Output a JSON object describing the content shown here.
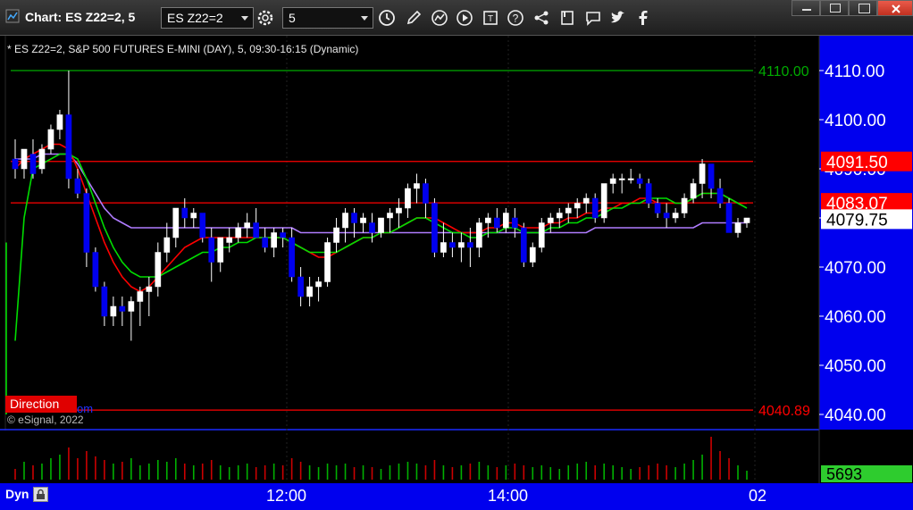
{
  "window": {
    "title": "Chart: ES Z22=2, 5",
    "symbol_value": "ES Z22=2",
    "interval_value": "5"
  },
  "chart": {
    "legend_text": "* ES Z22=2, S&P 500 FUTURES E-MINI (DAY), 5, 09:30-16:15 (Dynamic)",
    "copyright": "© eSignal, 2022",
    "direction_label": "Direction",
    "direction_tail": "om",
    "bottom_label": "Dyn"
  },
  "colors": {
    "background": "#000000",
    "price_axis_bg": "#0000ee",
    "up_candle": "#ffffff",
    "down_candle": "#0000ee",
    "ma_red": "#ff0000",
    "ma_green": "#00dd00",
    "ma_purple": "#b07cff",
    "level_green": "#00aa00",
    "level_red": "#ff0000",
    "volume_up": "#00b000",
    "volume_down": "#cc0000"
  },
  "icons": [
    "settings-icon",
    "clock-icon",
    "pencil-icon",
    "refresh-icon",
    "play-icon",
    "text-icon",
    "help-icon",
    "share-icon",
    "bookmark-icon",
    "chat-icon",
    "twitter-icon",
    "facebook-icon"
  ],
  "chart_data": {
    "type": "candlestick",
    "price_ticks": [
      4110,
      4100,
      4090,
      4080,
      4070,
      4060,
      4050,
      4040
    ],
    "price_tick_labels": [
      "4110.00",
      "4100.00",
      "4090.00",
      "4080.00",
      "4070.00",
      "4060.00",
      "4050.00",
      "4040.00"
    ],
    "ylim": [
      4036,
      4116
    ],
    "time_labels": [
      "12:00",
      "14:00",
      "02"
    ],
    "last_price": "4079.75",
    "last_volume": "5693",
    "levels": [
      {
        "value": 4110.0,
        "label": "4110.00",
        "color": "#00aa00",
        "box": false
      },
      {
        "value": 4091.5,
        "label": "4091.50",
        "color": "#ff0000",
        "box": true
      },
      {
        "value": 4083.07,
        "label": "4083.07",
        "color": "#ff0000",
        "box": true
      },
      {
        "value": 4040.89,
        "label": "4040.89",
        "color": "#ff0000",
        "box": false
      }
    ],
    "candles": [
      [
        4092,
        4096,
        4088,
        4090
      ],
      [
        4090,
        4094,
        4088,
        4094
      ],
      [
        4093,
        4096,
        4088,
        4089
      ],
      [
        4090,
        4095,
        4089,
        4094
      ],
      [
        4094,
        4099,
        4093,
        4098
      ],
      [
        4098,
        4102,
        4096,
        4101
      ],
      [
        4101,
        4110,
        4086,
        4088
      ],
      [
        4088,
        4090,
        4084,
        4085
      ],
      [
        4085,
        4086,
        4070,
        4073
      ],
      [
        4073,
        4074,
        4065,
        4066
      ],
      [
        4066,
        4067,
        4058,
        4060
      ],
      [
        4060,
        4064,
        4058,
        4062
      ],
      [
        4062,
        4064,
        4058,
        4061
      ],
      [
        4061,
        4064,
        4055,
        4063
      ],
      [
        4063,
        4066,
        4058,
        4065
      ],
      [
        4065,
        4068,
        4060,
        4066
      ],
      [
        4066,
        4075,
        4064,
        4073
      ],
      [
        4073,
        4079,
        4071,
        4076
      ],
      [
        4076,
        4082,
        4074,
        4082
      ],
      [
        4082,
        4084,
        4078,
        4080
      ],
      [
        4080,
        4082,
        4078,
        4081
      ],
      [
        4081,
        4081,
        4075,
        4076
      ],
      [
        4076,
        4078,
        4067,
        4071
      ],
      [
        4071,
        4076,
        4069,
        4076
      ],
      [
        4075,
        4078,
        4073,
        4076
      ],
      [
        4076,
        4079,
        4075,
        4078
      ],
      [
        4078,
        4081,
        4076,
        4079
      ],
      [
        4079,
        4082,
        4076,
        4076
      ],
      [
        4076,
        4078,
        4073,
        4074
      ],
      [
        4074,
        4078,
        4072,
        4077
      ],
      [
        4077,
        4078,
        4074,
        4076
      ],
      [
        4076,
        4078,
        4067,
        4068
      ],
      [
        4068,
        4070,
        4062,
        4064
      ],
      [
        4064,
        4068,
        4062,
        4066
      ],
      [
        4066,
        4068,
        4063,
        4067
      ],
      [
        4067,
        4076,
        4066,
        4075
      ],
      [
        4075,
        4080,
        4073,
        4078
      ],
      [
        4078,
        4082,
        4075,
        4081
      ],
      [
        4081,
        4082,
        4076,
        4079
      ],
      [
        4079,
        4081,
        4077,
        4080
      ],
      [
        4079,
        4081,
        4075,
        4077
      ],
      [
        4077,
        4080,
        4076,
        4080
      ],
      [
        4080,
        4082,
        4077,
        4081
      ],
      [
        4081,
        4084,
        4078,
        4082
      ],
      [
        4082,
        4087,
        4080,
        4086
      ],
      [
        4086,
        4089,
        4083,
        4087
      ],
      [
        4087,
        4088,
        4080,
        4083
      ],
      [
        4083,
        4084,
        4072,
        4073
      ],
      [
        4073,
        4079,
        4072,
        4075
      ],
      [
        4075,
        4077,
        4072,
        4074
      ],
      [
        4074,
        4077,
        4071,
        4075
      ],
      [
        4075,
        4078,
        4070,
        4074
      ],
      [
        4074,
        4080,
        4072,
        4079
      ],
      [
        4079,
        4081,
        4076,
        4080
      ],
      [
        4080,
        4082,
        4077,
        4078
      ],
      [
        4078,
        4082,
        4077,
        4081
      ],
      [
        4080,
        4082,
        4076,
        4078
      ],
      [
        4078,
        4079,
        4070,
        4071
      ],
      [
        4071,
        4075,
        4070,
        4074
      ],
      [
        4074,
        4080,
        4073,
        4079
      ],
      [
        4079,
        4081,
        4077,
        4080
      ],
      [
        4080,
        4082,
        4078,
        4081
      ],
      [
        4081,
        4083,
        4079,
        4082
      ],
      [
        4082,
        4084,
        4080,
        4083
      ],
      [
        4083,
        4085,
        4081,
        4084
      ],
      [
        4084,
        4085,
        4079,
        4080
      ],
      [
        4080,
        4087,
        4079,
        4087
      ],
      [
        4087,
        4089,
        4085,
        4088
      ],
      [
        4088,
        4089,
        4085,
        4088
      ],
      [
        4088,
        4090,
        4087,
        4088
      ],
      [
        4088,
        4089,
        4086,
        4087
      ],
      [
        4087,
        4088,
        4082,
        4083
      ],
      [
        4083,
        4084,
        4080,
        4081
      ],
      [
        4081,
        4083,
        4078,
        4080
      ],
      [
        4080,
        4082,
        4079,
        4081
      ],
      [
        4081,
        4085,
        4080,
        4084
      ],
      [
        4084,
        4088,
        4083,
        4087
      ],
      [
        4087,
        4092,
        4084,
        4091
      ],
      [
        4091,
        4091,
        4084,
        4086
      ],
      [
        4086,
        4088,
        4082,
        4083
      ],
      [
        4083,
        4084,
        4077,
        4077
      ],
      [
        4077,
        4080,
        4076,
        4079
      ],
      [
        4079,
        4080,
        4078,
        4080
      ]
    ],
    "ma_red": [
      4090,
      4092,
      4093,
      4094,
      4095,
      4095,
      4094,
      4090,
      4085,
      4080,
      4075,
      4071,
      4068,
      4066,
      4065,
      4066,
      4068,
      4070,
      4072,
      4074,
      4075,
      4076,
      4076,
      4076,
      4076,
      4076,
      4076,
      4076,
      4076,
      4076,
      4076,
      4075,
      4074,
      4073,
      4072,
      4072,
      4073,
      4074,
      4075,
      4076,
      4076,
      4077,
      4077,
      4078,
      4079,
      4080,
      4080,
      4080,
      4079,
      4078,
      4077,
      4077,
      4077,
      4078,
      4078,
      4079,
      4079,
      4078,
      4078,
      4078,
      4079,
      4079,
      4080,
      4080,
      4081,
      4081,
      4082,
      4082,
      4083,
      4083,
      4084,
      4084,
      4083,
      4083,
      4083,
      4083,
      4084,
      4085,
      4085,
      4085,
      4084,
      4083,
      4083
    ],
    "ma_green": [
      4055,
      4080,
      4090,
      4091,
      4092,
      4093,
      4093,
      4092,
      4088,
      4083,
      4078,
      4074,
      4071,
      4069,
      4068,
      4068,
      4068,
      4069,
      4070,
      4071,
      4072,
      4073,
      4073,
      4074,
      4074,
      4075,
      4075,
      4076,
      4076,
      4076,
      4076,
      4075,
      4074,
      4073,
      4073,
      4073,
      4073,
      4074,
      4075,
      4076,
      4076,
      4077,
      4077,
      4078,
      4079,
      4080,
      4080,
      4079,
      4078,
      4077,
      4077,
      4076,
      4076,
      4077,
      4077,
      4078,
      4078,
      4077,
      4077,
      4077,
      4078,
      4078,
      4079,
      4079,
      4080,
      4080,
      4081,
      4082,
      4082,
      4083,
      4083,
      4084,
      4084,
      4084,
      4083,
      4083,
      4084,
      4085,
      4085,
      4085,
      4084,
      4083,
      4082
    ],
    "ma_purple": [
      4092,
      4092,
      4092,
      4093,
      4093,
      4093,
      4093,
      4091,
      4088,
      4085,
      4082,
      4080,
      4079,
      4078,
      4078,
      4078,
      4078,
      4078,
      4078,
      4078,
      4078,
      4078,
      4078,
      4078,
      4078,
      4078,
      4078,
      4078,
      4078,
      4078,
      4078,
      4078,
      4077,
      4077,
      4077,
      4077,
      4077,
      4077,
      4077,
      4077,
      4077,
      4077,
      4077,
      4077,
      4077,
      4077,
      4077,
      4077,
      4077,
      4077,
      4077,
      4077,
      4077,
      4077,
      4077,
      4077,
      4077,
      4077,
      4077,
      4077,
      4077,
      4077,
      4077,
      4077,
      4077,
      4078,
      4078,
      4078,
      4078,
      4078,
      4078,
      4078,
      4078,
      4078,
      4078,
      4078,
      4078,
      4079,
      4079,
      4079,
      4079,
      4079,
      4079
    ],
    "volume": [
      6,
      10,
      8,
      9,
      12,
      14,
      18,
      12,
      16,
      13,
      11,
      9,
      10,
      12,
      8,
      9,
      11,
      10,
      12,
      9,
      8,
      9,
      11,
      8,
      7,
      8,
      9,
      7,
      8,
      9,
      8,
      12,
      10,
      8,
      7,
      9,
      8,
      9,
      7,
      8,
      7,
      6,
      8,
      9,
      10,
      9,
      8,
      11,
      8,
      7,
      8,
      9,
      10,
      8,
      7,
      8,
      9,
      8,
      7,
      8,
      7,
      6,
      8,
      9,
      10,
      8,
      9,
      8,
      7,
      6,
      7,
      8,
      9,
      8,
      7,
      9,
      11,
      14,
      24,
      16,
      12,
      8,
      5
    ]
  }
}
